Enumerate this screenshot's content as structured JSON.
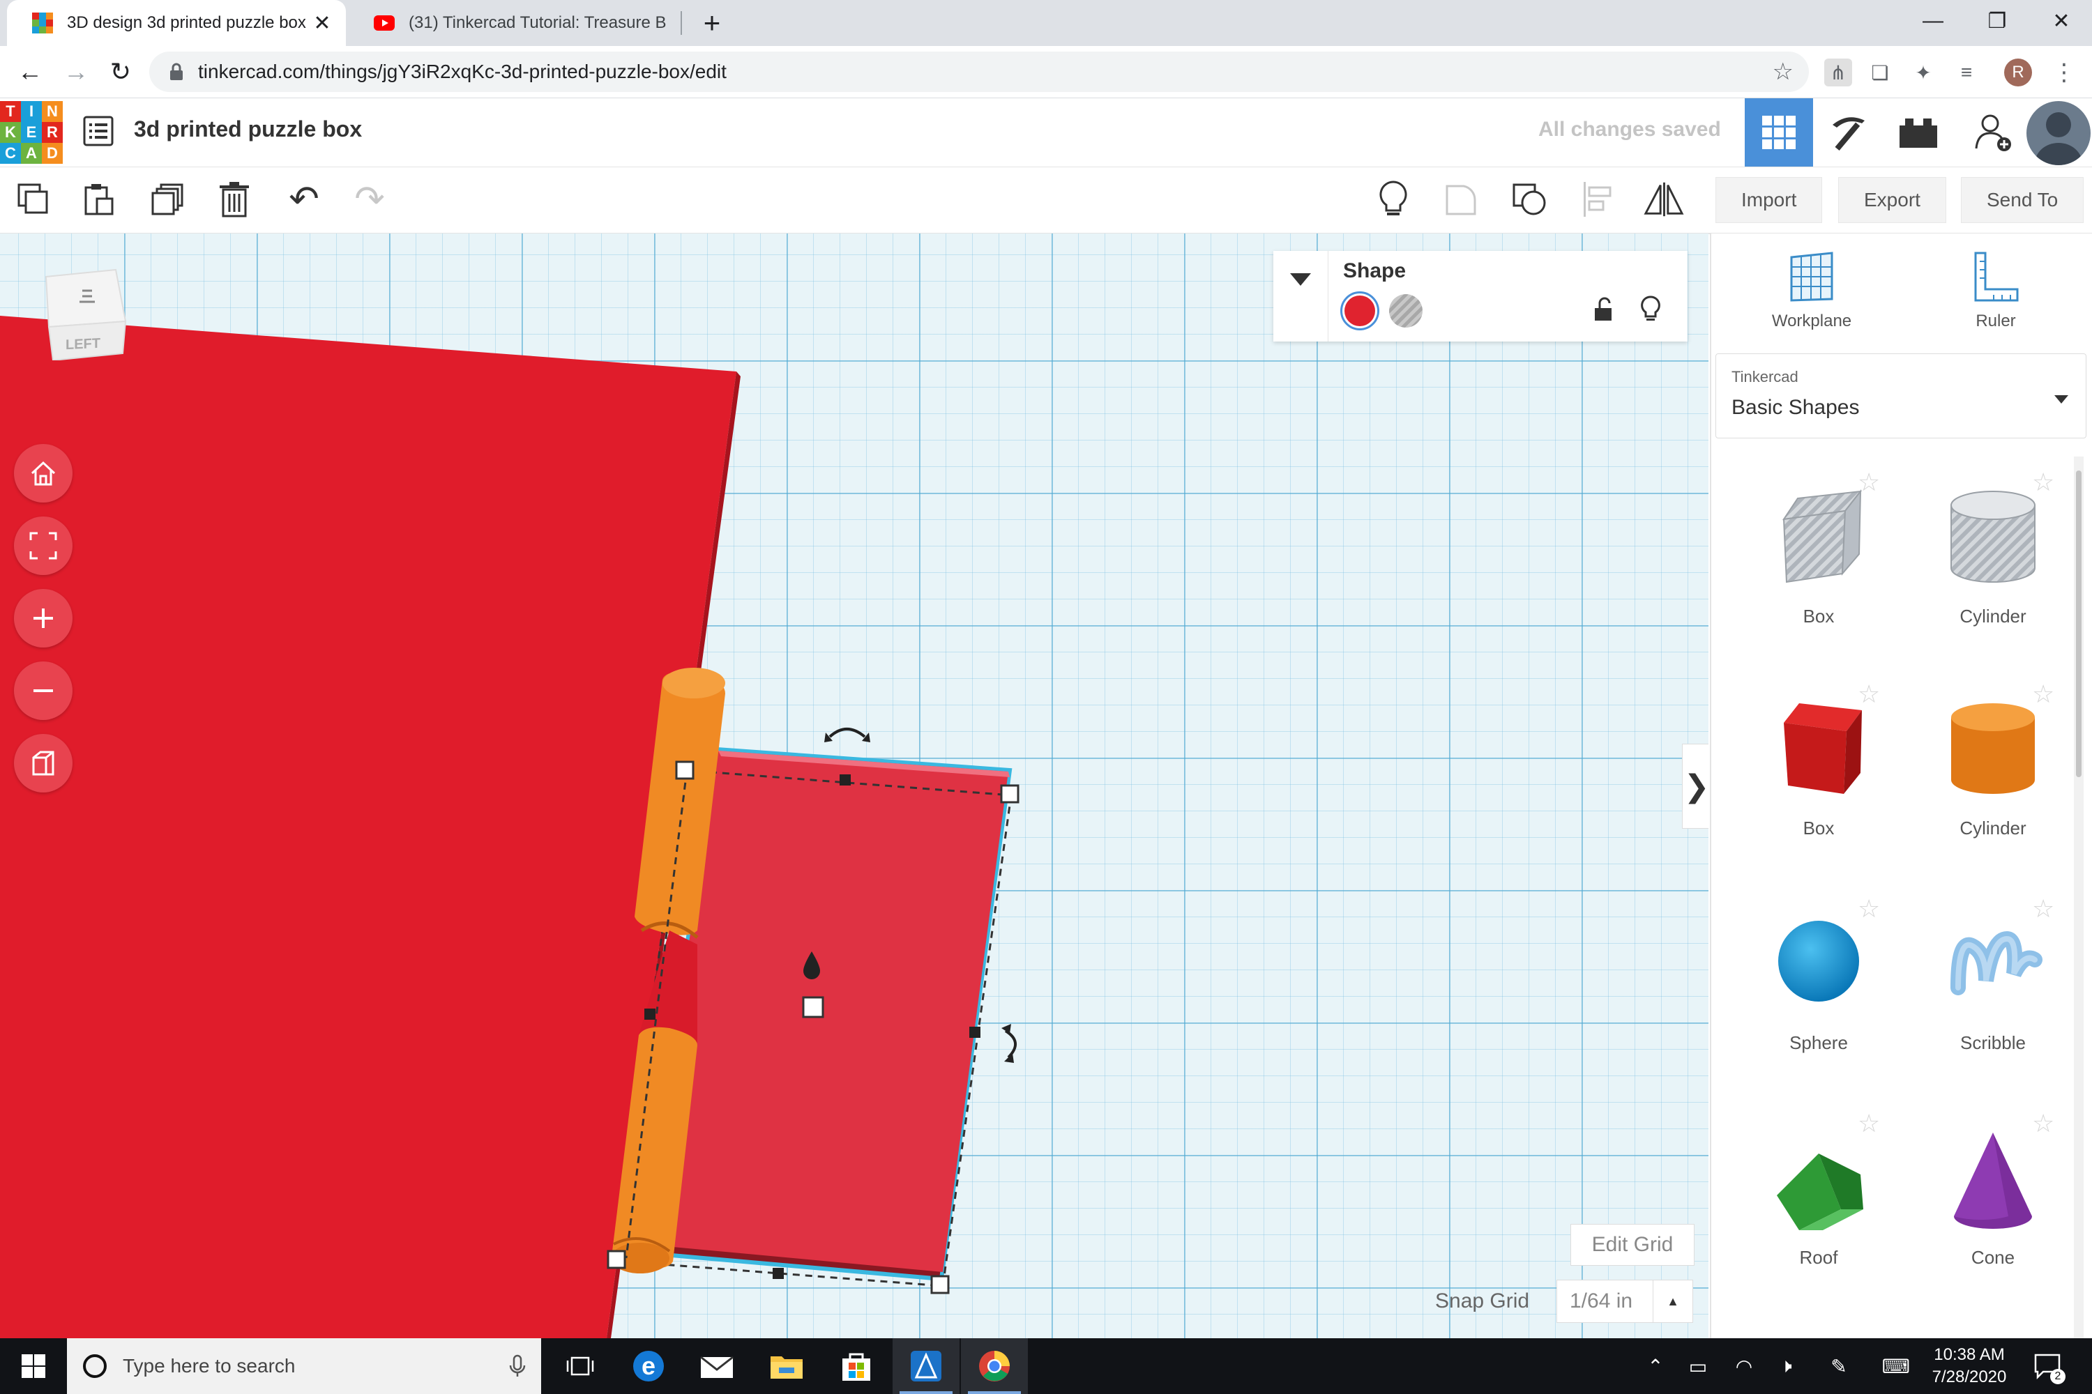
{
  "browser": {
    "tabs": [
      {
        "title": "3D design 3d printed puzzle box",
        "icon": "tinkercad-favicon",
        "active": true
      },
      {
        "title": "(31) Tinkercad Tutorial: Treasure B",
        "icon": "youtube-favicon",
        "active": false
      }
    ],
    "new_tab": "+",
    "url": "tinkercad.com/things/jgY3iR2xqKc-3d-printed-puzzle-box/edit",
    "profile_initial": "R"
  },
  "app": {
    "logo_letters": [
      "T",
      "I",
      "N",
      "K",
      "E",
      "R",
      "C",
      "A",
      "D"
    ],
    "logo_colors": [
      "#e2271e",
      "#1a9fd9",
      "#f58d1e",
      "#6db33f",
      "#1a9fd9",
      "#e2271e",
      "#1a9fd9",
      "#6db33f",
      "#f58d1e"
    ],
    "design_title": "3d printed puzzle box",
    "save_status": "All changes saved"
  },
  "toolbar": {
    "import_label": "Import",
    "export_label": "Export",
    "sendto_label": "Send To"
  },
  "viewcube": {
    "face_label": "LEFT"
  },
  "shape_panel": {
    "title": "Shape",
    "solid_color": "#e0232f"
  },
  "sidebar": {
    "workplane_label": "Workplane",
    "ruler_label": "Ruler",
    "library_source": "Tinkercad",
    "library_name": "Basic Shapes",
    "shapes": [
      {
        "label": "Box",
        "icon": "box-hole-icon"
      },
      {
        "label": "Cylinder",
        "icon": "cylinder-hole-icon"
      },
      {
        "label": "Box",
        "icon": "box-solid-icon"
      },
      {
        "label": "Cylinder",
        "icon": "cylinder-solid-icon"
      },
      {
        "label": "Sphere",
        "icon": "sphere-icon"
      },
      {
        "label": "Scribble",
        "icon": "scribble-icon"
      },
      {
        "label": "Roof",
        "icon": "roof-icon"
      },
      {
        "label": "Cone",
        "icon": "cone-icon"
      }
    ]
  },
  "grid": {
    "edit_label": "Edit Grid",
    "snap_label": "Snap Grid",
    "snap_value": "1/64 in"
  },
  "taskbar": {
    "search_placeholder": "Type here to search",
    "time": "10:38 AM",
    "date": "7/28/2020",
    "notification_count": "2"
  },
  "colors": {
    "red_shape": "#e0232f",
    "orange_shape": "#f08a24",
    "accent_blue": "#4a90d9"
  }
}
